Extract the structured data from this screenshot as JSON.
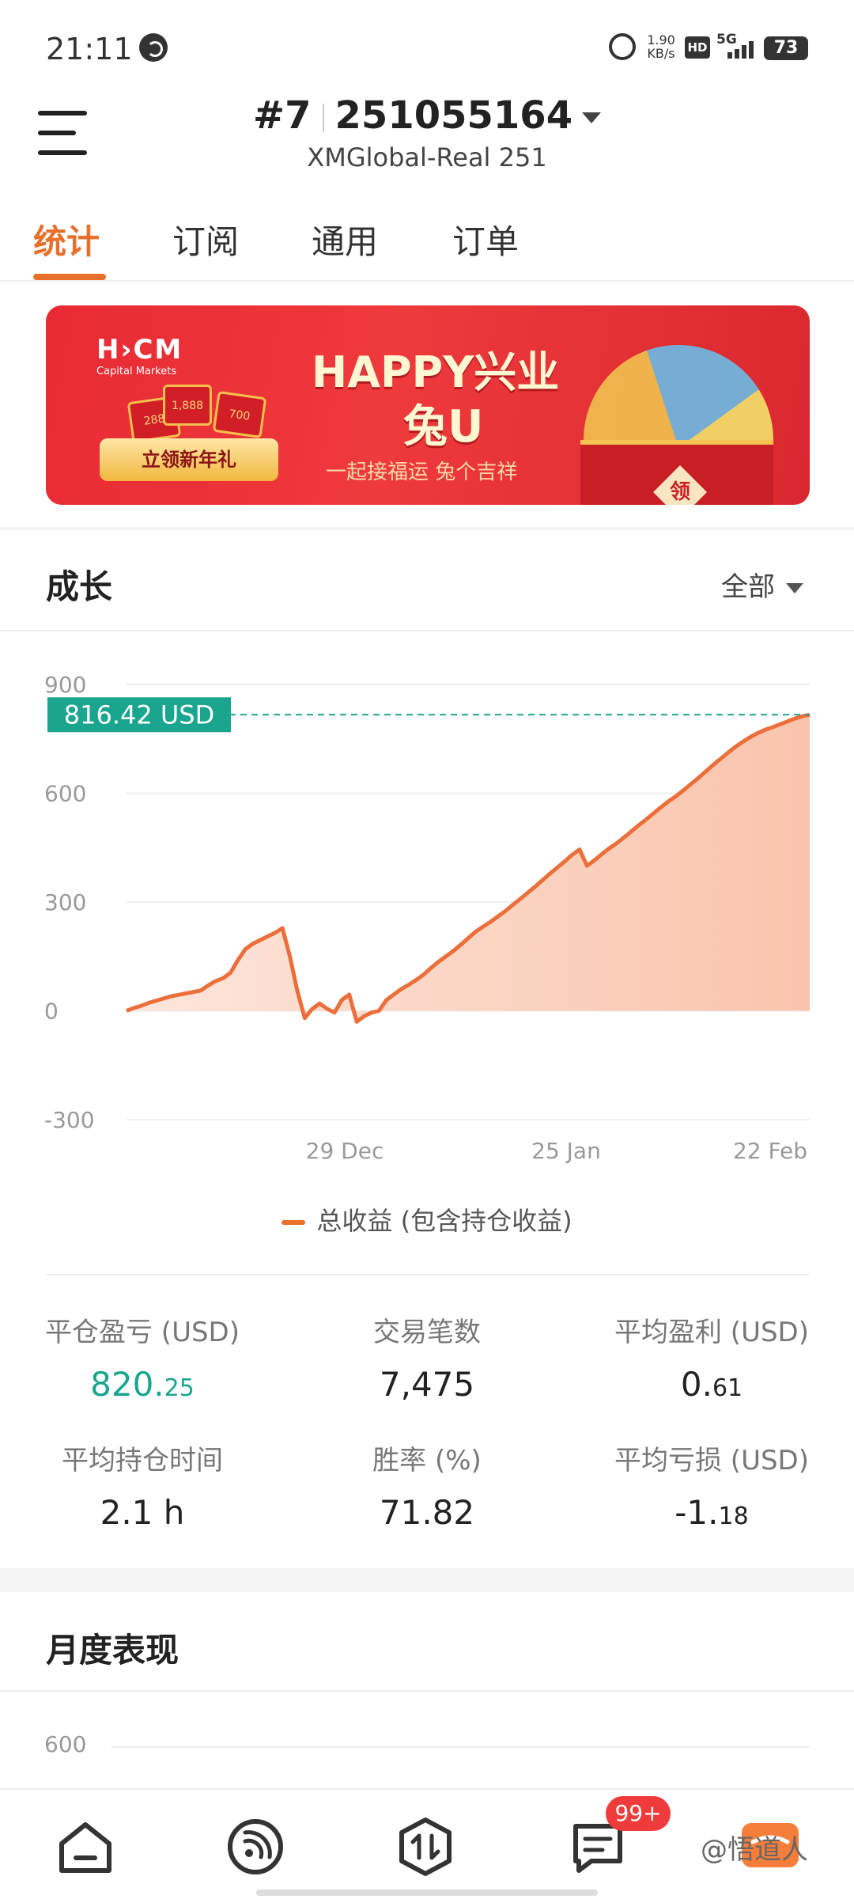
{
  "status_bar": {
    "time": "21:11",
    "speed_value": "1.90",
    "speed_unit": "KB/s",
    "hd": "HD",
    "network": "5G",
    "battery": "73"
  },
  "header": {
    "account_index": "#7",
    "account_number": "251055164",
    "server": "XMGlobal-Real 251"
  },
  "tabs": [
    {
      "label": "统计"
    },
    {
      "label": "订阅"
    },
    {
      "label": "通用"
    },
    {
      "label": "订单"
    }
  ],
  "banner": {
    "logo": "H›CM",
    "logo_sub": "Capital Markets",
    "env1": "288",
    "env2": "1,888",
    "env3": "700",
    "button": "立领新年礼",
    "title_line1": "HAPPY兴业",
    "title_line2": "兔U",
    "slogan": "一起接福运 兔个吉祥",
    "box_label": "领"
  },
  "growth": {
    "title": "成长",
    "filter": "全部"
  },
  "chart_data": {
    "type": "area",
    "y_ticks": [
      "900",
      "600",
      "300",
      "0",
      "-300"
    ],
    "ylim": [
      -300,
      900
    ],
    "x_ticks": [
      "29 Dec",
      "25 Jan",
      "22 Feb"
    ],
    "current_label": "816.42 USD",
    "current_value": 816.42,
    "series": [
      {
        "name": "总收益 (包含持仓收益)",
        "values": [
          0,
          8,
          14,
          22,
          28,
          34,
          40,
          44,
          48,
          52,
          56,
          70,
          82,
          90,
          105,
          140,
          170,
          185,
          195,
          205,
          215,
          228,
          150,
          55,
          -20,
          5,
          20,
          6,
          -5,
          30,
          45,
          -30,
          -15,
          -5,
          0,
          30,
          45,
          60,
          72,
          85,
          100,
          118,
          135,
          150,
          165,
          182,
          200,
          218,
          232,
          245,
          260,
          275,
          292,
          308,
          325,
          342,
          360,
          378,
          395,
          412,
          430,
          445,
          400,
          415,
          432,
          448,
          462,
          478,
          495,
          512,
          528,
          545,
          562,
          578,
          592,
          608,
          625,
          642,
          660,
          678,
          695,
          712,
          728,
          742,
          755,
          766,
          775,
          782,
          790,
          798,
          806,
          812,
          816.42
        ]
      }
    ],
    "grid": true
  },
  "stats": [
    {
      "label": "平仓盈亏 (USD)",
      "value_main": "820.",
      "value_small": "25",
      "color": "#1aa58f"
    },
    {
      "label": "交易笔数",
      "value_main": "7,475",
      "value_small": ""
    },
    {
      "label": "平均盈利 (USD)",
      "value_main": "0.",
      "value_small": "61"
    },
    {
      "label": "平均持仓时间",
      "value_main": "2.1 h",
      "value_small": ""
    },
    {
      "label": "胜率 (%)",
      "value_main": "71.82",
      "value_small": ""
    },
    {
      "label": "平均亏损 (USD)",
      "value_main": "-1.",
      "value_small": "18"
    }
  ],
  "monthly": {
    "title": "月度表现",
    "axis_top": "600"
  },
  "bottom_nav": {
    "badge": "99+",
    "watermark": "@悟道人",
    "icons": [
      "home-icon",
      "signal-icon",
      "trade-icon",
      "news-icon",
      "profile-icon"
    ]
  },
  "colors": {
    "accent": "#e8702a",
    "green": "#1aa58f",
    "chart_fill": "#fbd6c6"
  }
}
